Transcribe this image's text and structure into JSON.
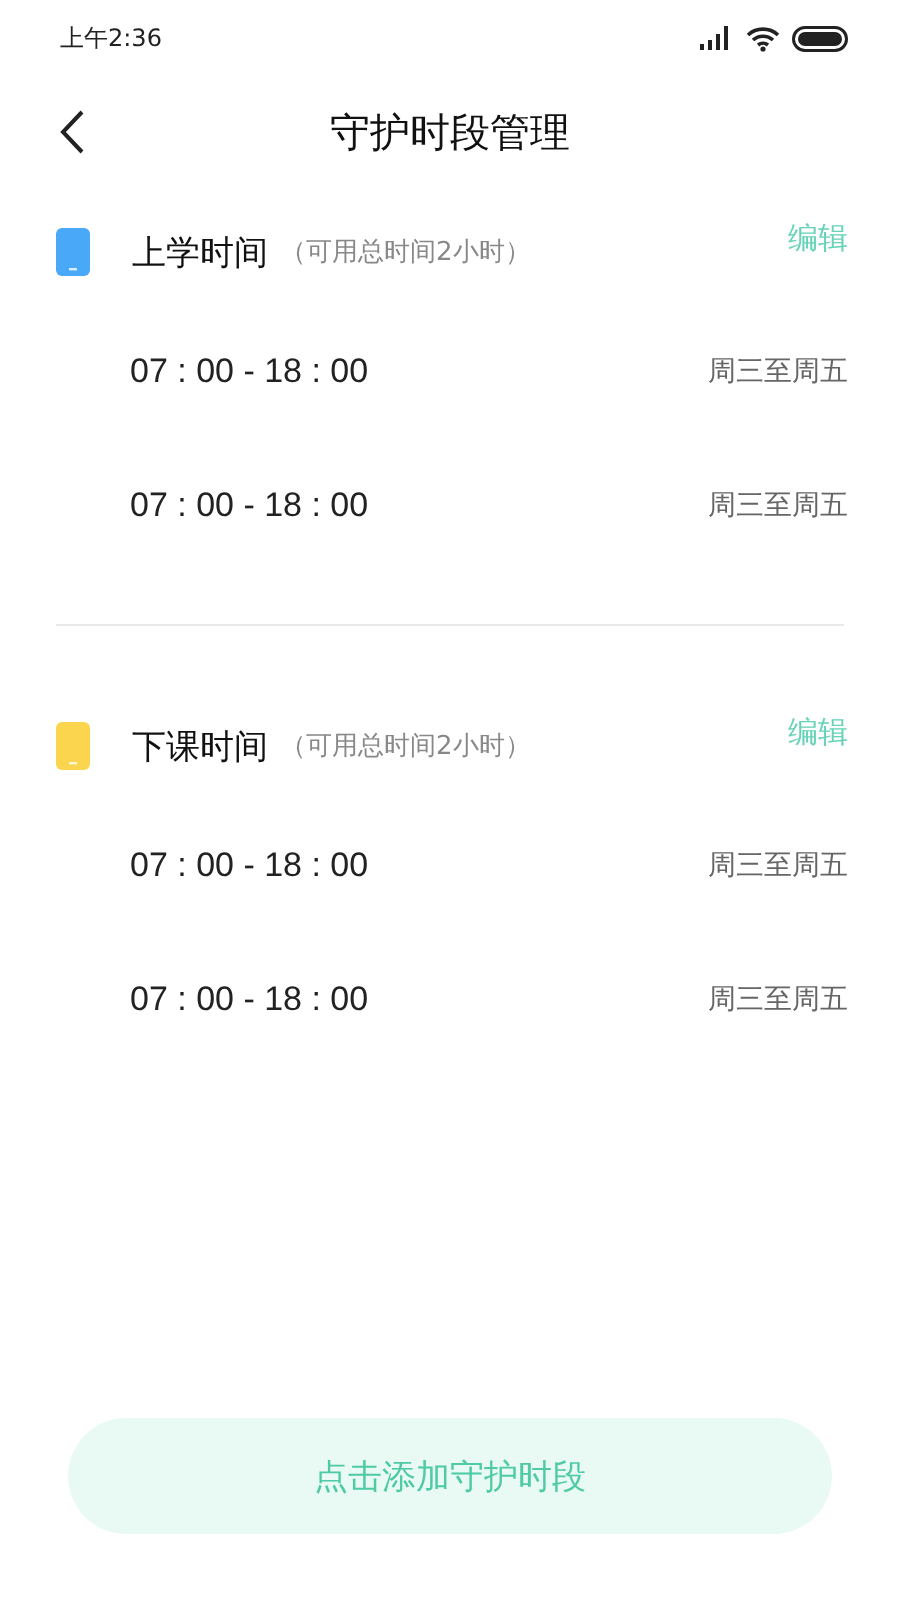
{
  "status_bar": {
    "time": "上午2:36"
  },
  "header": {
    "title": "守护时段管理"
  },
  "sections": [
    {
      "title": "上学时间",
      "note": "（可用总时间2小时）",
      "color": "#4aa8f8",
      "action": "编辑",
      "periods": [
        {
          "time": "07 : 00 - 18 : 00",
          "days": "周三至周五"
        },
        {
          "time": "07 : 00 - 18 : 00",
          "days": "周三至周五"
        }
      ]
    },
    {
      "title": "下课时间",
      "note": "（可用总时间2小时）",
      "color": "#fbd54e",
      "action": "编辑",
      "periods": [
        {
          "time": "07 : 00 - 18 : 00",
          "days": "周三至周五"
        },
        {
          "time": "07 : 00 - 18 : 00",
          "days": "周三至周五"
        }
      ]
    }
  ],
  "add_button": "点击添加守护时段"
}
